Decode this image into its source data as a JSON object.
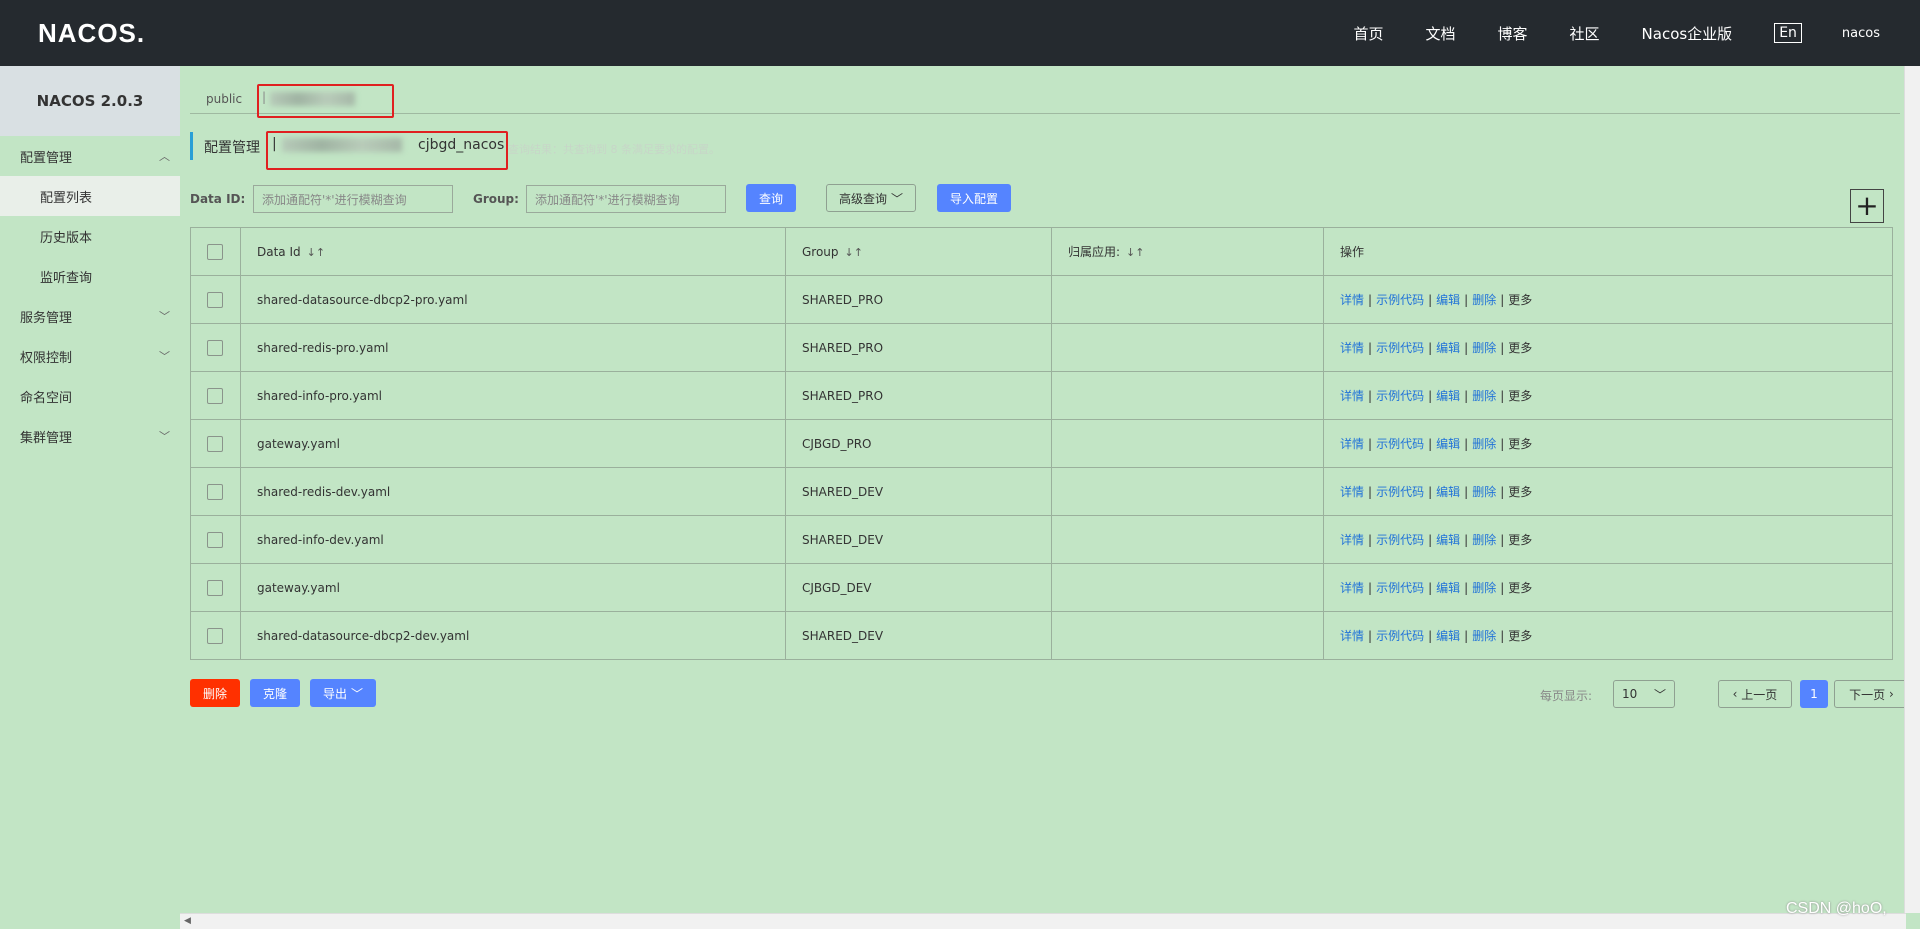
{
  "header": {
    "logo": "NACOS.",
    "nav": [
      "首页",
      "文档",
      "博客",
      "社区",
      "Nacos企业版"
    ],
    "lang": "En",
    "user": "nacos"
  },
  "sidebar": {
    "title": "NACOS 2.0.3",
    "groups": [
      {
        "label": "配置管理",
        "expanded": true,
        "items": [
          "配置列表",
          "历史版本",
          "监听查询"
        ]
      },
      {
        "label": "服务管理",
        "expanded": false
      },
      {
        "label": "权限控制",
        "expanded": false
      },
      {
        "label": "命名空间"
      },
      {
        "label": "集群管理",
        "expanded": false
      }
    ],
    "active_item": "配置列表"
  },
  "namespace_bar": {
    "current": "public"
  },
  "crumb": {
    "title": "配置管理",
    "sep": "|",
    "namespace": "cjbgd_nacos",
    "hint": "查询结果：共查询到 8 条满足要求的配置。"
  },
  "search": {
    "data_id_label": "Data ID:",
    "data_id_placeholder": "添加通配符'*'进行模糊查询",
    "group_label": "Group:",
    "group_placeholder": "添加通配符'*'进行模糊查询",
    "query_btn": "查询",
    "advanced_btn": "高级查询",
    "import_btn": "导入配置"
  },
  "table": {
    "headers": [
      "Data Id",
      "Group",
      "归属应用:",
      "操作"
    ],
    "rows": [
      {
        "data_id": "shared-datasource-dbcp2-pro.yaml",
        "group": "SHARED_PRO",
        "app": ""
      },
      {
        "data_id": "shared-redis-pro.yaml",
        "group": "SHARED_PRO",
        "app": ""
      },
      {
        "data_id": "shared-info-pro.yaml",
        "group": "SHARED_PRO",
        "app": ""
      },
      {
        "data_id": "gateway.yaml",
        "group": "CJBGD_PRO",
        "app": ""
      },
      {
        "data_id": "shared-redis-dev.yaml",
        "group": "SHARED_DEV",
        "app": ""
      },
      {
        "data_id": "shared-info-dev.yaml",
        "group": "SHARED_DEV",
        "app": ""
      },
      {
        "data_id": "gateway.yaml",
        "group": "CJBGD_DEV",
        "app": ""
      },
      {
        "data_id": "shared-datasource-dbcp2-dev.yaml",
        "group": "SHARED_DEV",
        "app": ""
      }
    ],
    "ops": {
      "detail": "详情",
      "sample": "示例代码",
      "edit": "编辑",
      "delete": "删除",
      "more": "更多"
    }
  },
  "footer": {
    "delete_btn": "删除",
    "clone_btn": "克隆",
    "export_btn": "导出",
    "page_size_label": "每页显示:",
    "page_size": "10",
    "prev": "上一页",
    "current_page": "1",
    "next": "下一页"
  },
  "watermark": "CSDN @hoO,",
  "colors": {
    "header_bg": "#252a2f",
    "page_bg": "#c2e5c5",
    "primary": "#5584ff",
    "danger": "#ff3000",
    "link": "#2173d8",
    "highlight_box": "#e02020"
  }
}
